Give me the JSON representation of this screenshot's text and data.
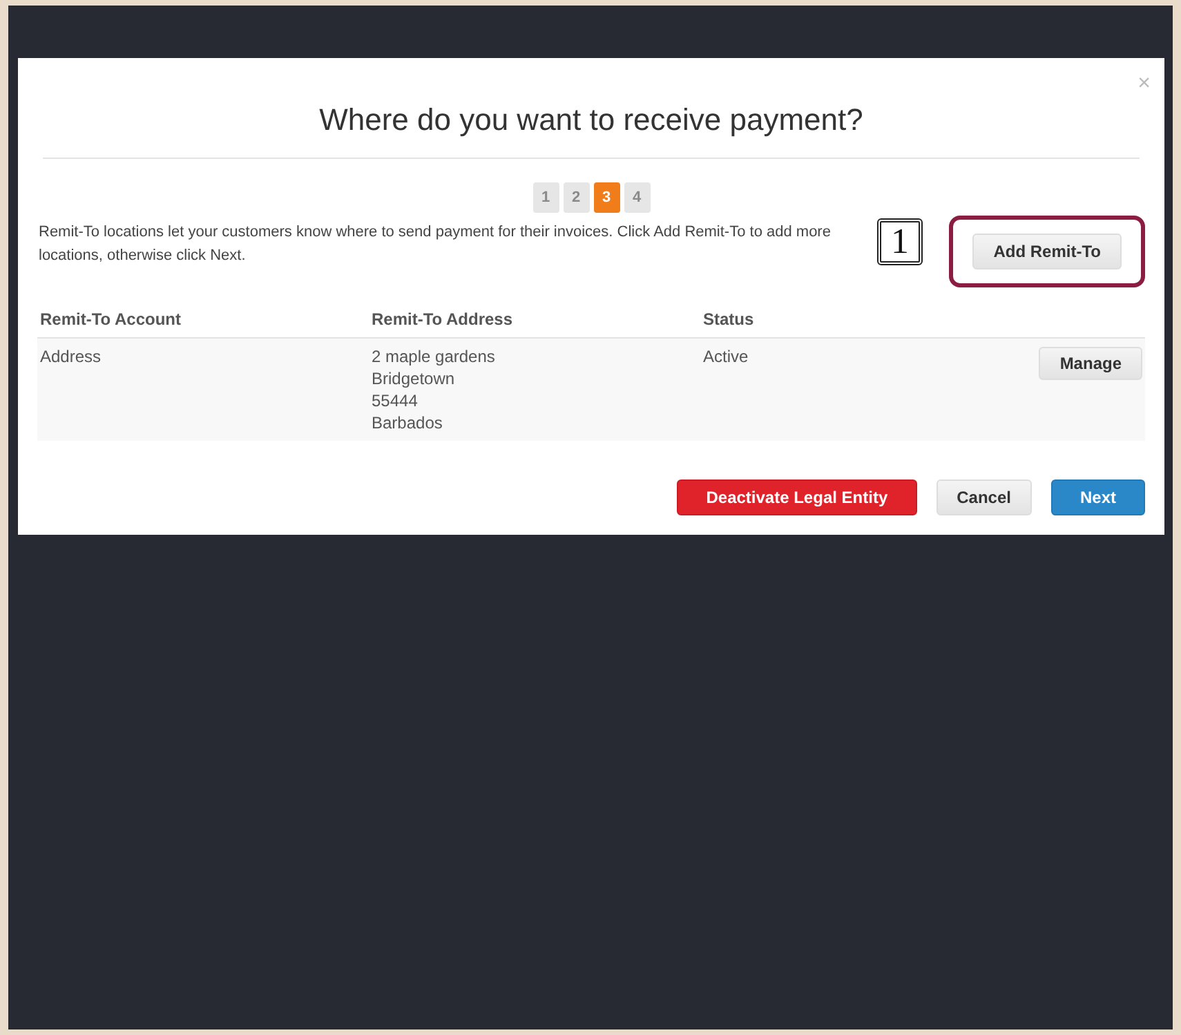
{
  "dialog": {
    "title": "Where do you want to receive payment?",
    "close": "×",
    "steps": [
      {
        "label": "1",
        "selected": false
      },
      {
        "label": "2",
        "selected": false
      },
      {
        "label": "3",
        "selected": true
      },
      {
        "label": "4",
        "selected": false
      }
    ],
    "description": "Remit-To locations let your customers know where to send payment for their invoices. Click Add Remit-To to add more locations, otherwise click Next.",
    "callout": "1",
    "add_button": "Add Remit-To",
    "table": {
      "columns": [
        "Remit-To Account",
        "Remit-To Address",
        "Status"
      ],
      "rows": [
        {
          "account": "Address",
          "address": [
            "2 maple gardens",
            "Bridgetown",
            "55444",
            "Barbados"
          ],
          "status": "Active",
          "action": "Manage"
        }
      ]
    },
    "buttons": [
      {
        "kind": "danger",
        "label": "Deactivate Legal Entity"
      },
      {
        "kind": "default",
        "label": "Cancel"
      },
      {
        "kind": "primary",
        "label": "Next"
      }
    ]
  }
}
